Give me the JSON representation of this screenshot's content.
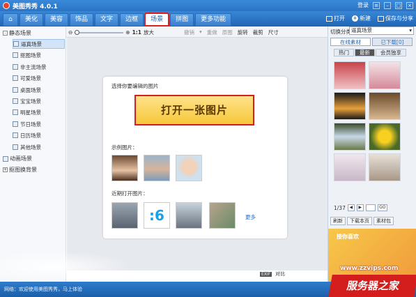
{
  "titlebar": {
    "title": "美图秀秀 4.0.1",
    "login": "登录"
  },
  "nav": {
    "tabs": [
      {
        "label": "美化"
      },
      {
        "label": "美容"
      },
      {
        "label": "饰品"
      },
      {
        "label": "文字"
      },
      {
        "label": "边框"
      },
      {
        "label": "场景",
        "active": true
      },
      {
        "label": "拼图"
      },
      {
        "label": "更多功能"
      }
    ],
    "actions": {
      "open": "打开",
      "new": "新建",
      "save": "保存与分享"
    }
  },
  "toolbar": {
    "zoom_label": "1:1",
    "enlarge": "放大",
    "undo": "撤销",
    "redo": "重做",
    "original": "原图",
    "rotate": "旋转",
    "crop": "裁剪",
    "size": "尺寸"
  },
  "left_panel": {
    "categories": [
      {
        "label": "静态场景",
        "items": [
          "逼真场景",
          "抠图场景",
          "非主流场景",
          "可爱场景",
          "桌面场景",
          "宝宝场景",
          "明星场景",
          "节日场景",
          "日历场景",
          "其他场景"
        ]
      },
      {
        "label": "动画场景"
      },
      {
        "label": "抠图换背景"
      }
    ]
  },
  "main": {
    "prompt": "选择你要编辑的图片",
    "open_button": "打开一张图片",
    "sample_label": "示例图片：",
    "recent_label": "近期打开图片：",
    "more_link": "更多"
  },
  "right_panel": {
    "switch_label": "切换分类",
    "category_value": "逼真场景",
    "tabs": [
      "在线素材",
      "已下载[0]"
    ],
    "subtabs": [
      "热门",
      "最新",
      "会员独享"
    ],
    "page_info": "1/37",
    "go_button": "GO",
    "actions": [
      "刷新",
      "下载本页",
      "素材包"
    ],
    "banner_text": "接你喜欢"
  },
  "status": {
    "text": "网络：欢迎使用美图秀秀，马上体验",
    "exif": "EXIF",
    "compare": "对比"
  },
  "watermark": {
    "url": "www.zzvips.com",
    "brand": "服务器之家"
  }
}
